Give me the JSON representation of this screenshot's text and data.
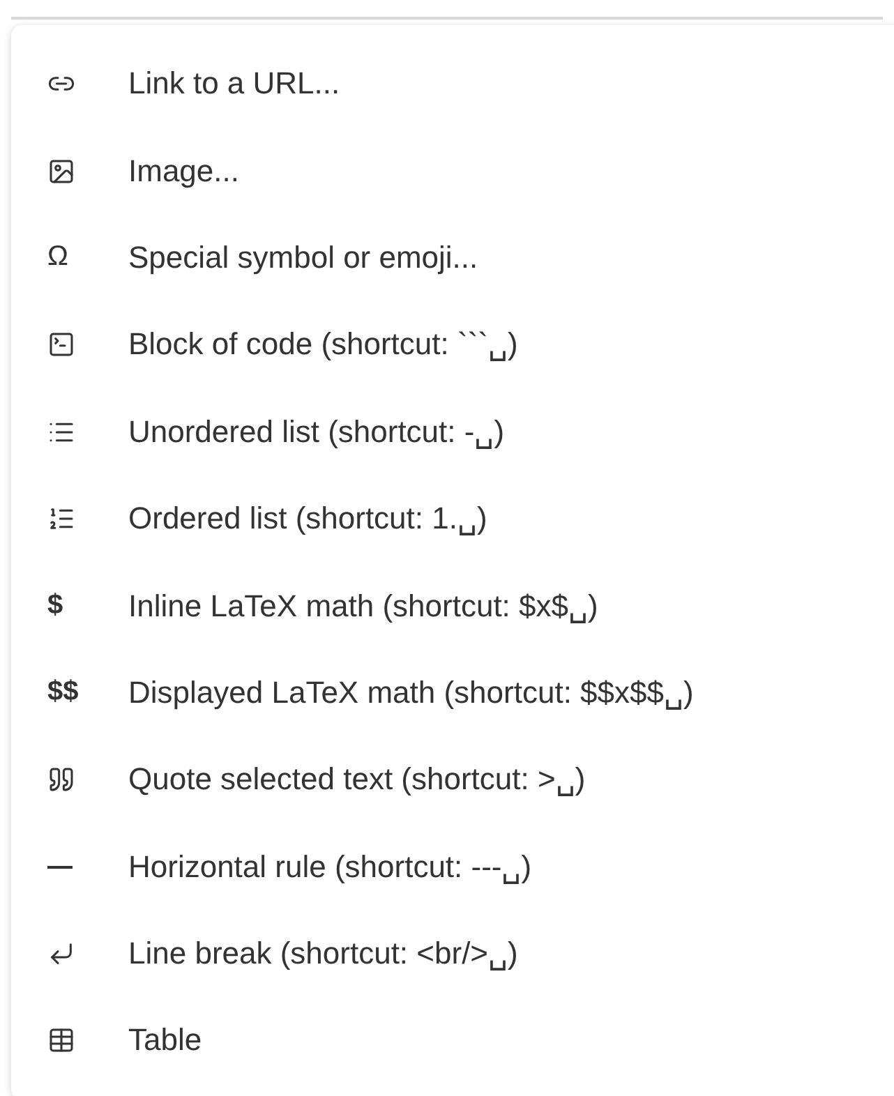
{
  "menu": {
    "items": [
      {
        "kind": "link",
        "label": "Link to a URL..."
      },
      {
        "kind": "image",
        "label": "Image..."
      },
      {
        "kind": "glyph",
        "glyph": "Ω",
        "label": "Special symbol or emoji..."
      },
      {
        "kind": "code",
        "label": "Block of code (shortcut: ```␣)"
      },
      {
        "kind": "unordered",
        "label": "Unordered list (shortcut: -␣)"
      },
      {
        "kind": "ordered",
        "label": "Ordered list (shortcut: 1.␣)"
      },
      {
        "kind": "glyph",
        "glyph": "$",
        "label": "Inline LaTeX math (shortcut: $x$␣)"
      },
      {
        "kind": "glyph",
        "glyph": "$$",
        "label": "Displayed LaTeX math (shortcut: $$x$$␣)"
      },
      {
        "kind": "quote",
        "label": "Quote selected text (shortcut: >␣)"
      },
      {
        "kind": "rule",
        "label": "Horizontal rule (shortcut: ---␣)"
      },
      {
        "kind": "linebreak",
        "label": "Line break (shortcut: <br/>␣)"
      },
      {
        "kind": "table",
        "label": "Table"
      }
    ]
  }
}
